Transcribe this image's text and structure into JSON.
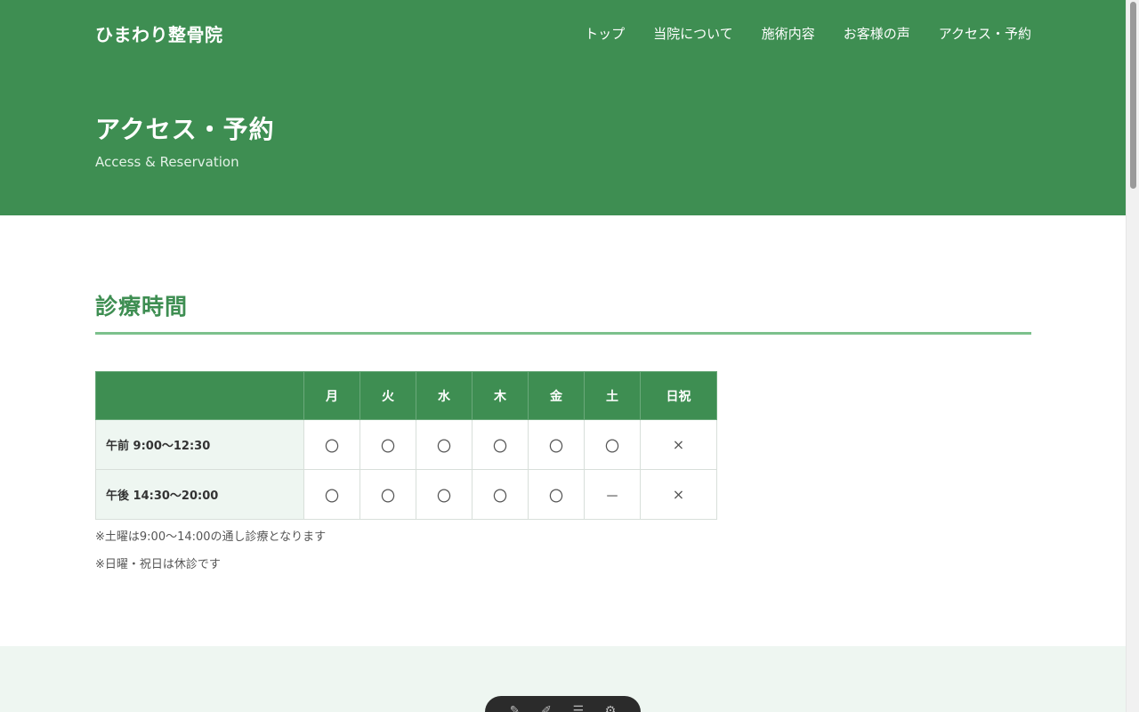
{
  "site": {
    "logo": "ひまわり整骨院"
  },
  "nav": {
    "items": [
      "トップ",
      "当院について",
      "施術内容",
      "お客様の声",
      "アクセス・予約"
    ]
  },
  "hero": {
    "title": "アクセス・予約",
    "subtitle": "Access & Reservation"
  },
  "hours": {
    "title": "診療時間",
    "columns": [
      "",
      "月",
      "火",
      "水",
      "木",
      "金",
      "土",
      "日祝"
    ],
    "rows": [
      {
        "label": "午前 9:00〜12:30",
        "cells": [
          "〇",
          "〇",
          "〇",
          "〇",
          "〇",
          "〇",
          "×"
        ]
      },
      {
        "label": "午後 14:30〜20:00",
        "cells": [
          "〇",
          "〇",
          "〇",
          "〇",
          "〇",
          "－",
          "×"
        ]
      }
    ],
    "notes": [
      "※土曜は9:00〜14:00の通し診療となります",
      "※日曜・祝日は休診です"
    ]
  },
  "colors": {
    "brand_green": "#3e8e52",
    "accent_rule": "#7cc18c",
    "row_label_bg": "#eef6f1"
  },
  "icons": {
    "floating_toolbar": [
      "pen-icon",
      "highlighter-icon",
      "menu-icon",
      "gear-icon"
    ]
  }
}
